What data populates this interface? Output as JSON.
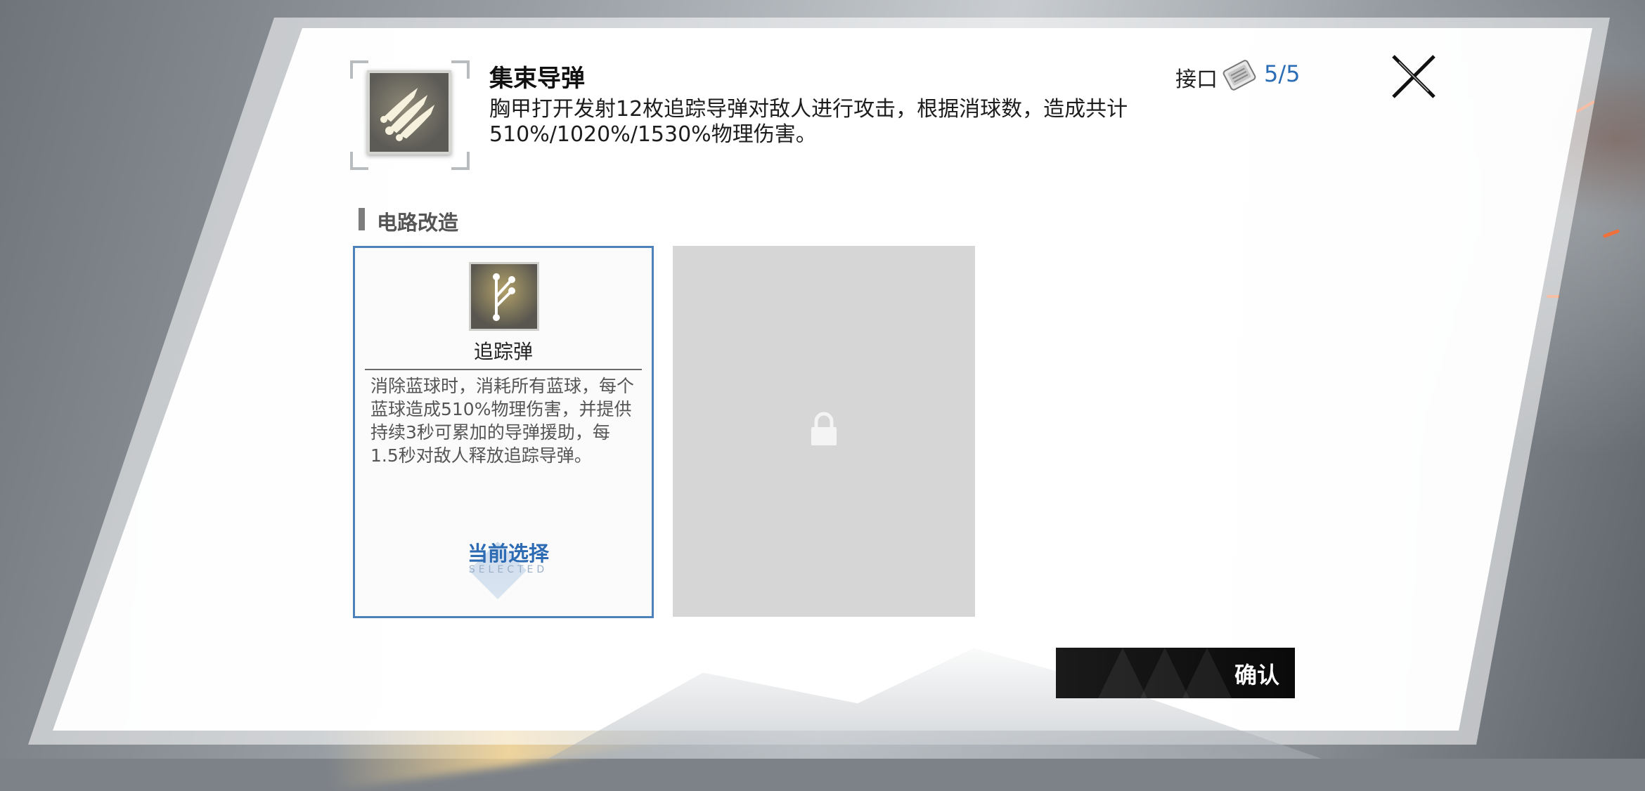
{
  "skill": {
    "title": "集束导弹",
    "description": "胸甲打开发射12枚追踪导弹对敌人进行攻击，根据消球数，造成共计510%/1020%/1530%物理伤害。",
    "icon": "missile-cluster-icon",
    "interface_label": "接口",
    "interface_icon": "chip-icon",
    "interface_count": "5/5"
  },
  "section": {
    "title": "电路改造"
  },
  "circuits": [
    {
      "name": "追踪弹",
      "icon": "branch-circuit-icon",
      "description": "消除蓝球时，消耗所有蓝球，每个蓝球造成510%物理伤害，并提供持续3秒可累加的导弹援助，每1.5秒对敌人释放追踪导弹。",
      "status": "当前选择",
      "status_sub": "SELECTED"
    },
    {
      "locked": true,
      "icon": "lock-icon"
    }
  ],
  "confirm": {
    "label": "确认"
  },
  "colors": {
    "accent": "#2d6bb3",
    "card_border": "#4d81b8",
    "locked_bg": "#d6d6d6"
  }
}
